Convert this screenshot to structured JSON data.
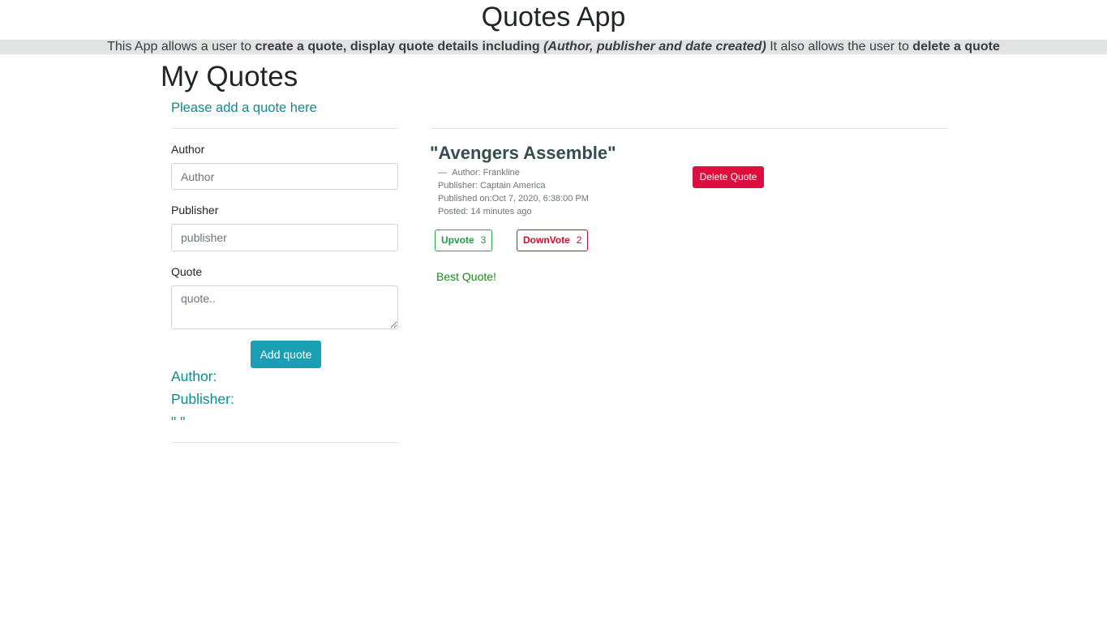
{
  "header": {
    "title": "Quotes App",
    "description": {
      "part1": "This App allows a user to ",
      "part2": "create a quote, display quote details including ",
      "part3": "(Author, publisher and date created)",
      "part4": " It also allows the user to ",
      "part5": "delete a quote"
    }
  },
  "section_title": "My Quotes",
  "form": {
    "add_link": "Please add a quote here",
    "author_label": "Author",
    "author_value": "",
    "author_placeholder": "Author",
    "publisher_label": "Publisher",
    "publisher_value": "",
    "publisher_placeholder": "publisher",
    "quote_label": "Quote",
    "quote_value": "",
    "quote_placeholder": "quote..",
    "submit_label": "Add quote"
  },
  "preview": {
    "author_label": "Author:",
    "publisher_label": "Publisher:",
    "quote_text": "\" \""
  },
  "quote": {
    "text": "\"Avengers Assemble\"",
    "dash": "—",
    "author": "Author: Frankline",
    "publisher": "Publisher: Captain America",
    "published": "Published on:Oct 7, 2020, 6:38:00 PM",
    "posted": "Posted: 14 minutes ago",
    "delete_label": "Delete Quote",
    "upvote_label": "Upvote",
    "upvote_count": "3",
    "downvote_label": "DownVote",
    "downvote_count": "2",
    "status": "Best Quote!"
  },
  "colors": {
    "accent": "#0f8b8d",
    "delete": "#dc0f3f",
    "upvote": "#1e9e45",
    "downvote": "#c8102e"
  }
}
